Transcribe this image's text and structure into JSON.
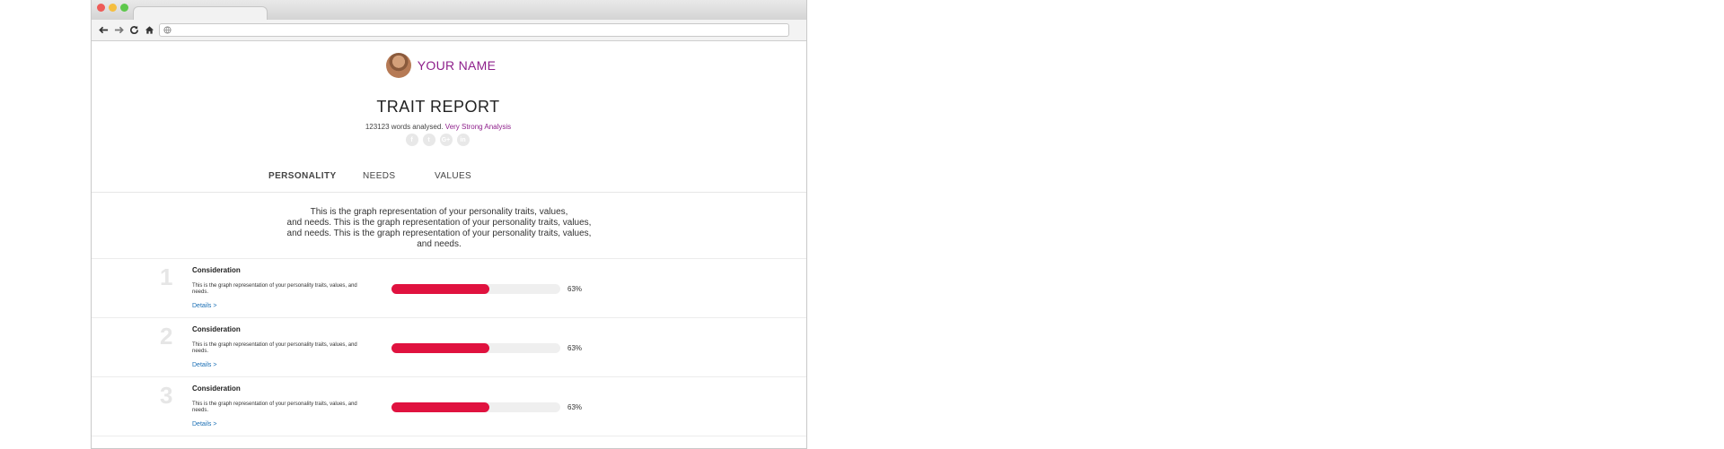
{
  "browser": {
    "traffic_colors": [
      "#ee5b58",
      "#f5be3f",
      "#5ec84c"
    ],
    "nav_icons": [
      "back-icon",
      "forward-icon",
      "reload-icon",
      "home-icon"
    ]
  },
  "profile": {
    "name": "YOUR NAME"
  },
  "report": {
    "title": "TRAIT REPORT",
    "words": "123123 words analysed.",
    "strength": "Very Strong Analysis"
  },
  "socials": [
    {
      "icon": "facebook-icon",
      "glyph": "f"
    },
    {
      "icon": "twitter-icon",
      "glyph": "t"
    },
    {
      "icon": "google-plus-icon",
      "glyph": "G+"
    },
    {
      "icon": "linkedin-icon",
      "glyph": "in"
    }
  ],
  "tabs": [
    {
      "label": "PERSONALITY",
      "active": true
    },
    {
      "label": "NEEDS",
      "active": false
    },
    {
      "label": "VALUES",
      "active": false
    }
  ],
  "intro": [
    "This is the graph representation of your personality traits, values,",
    "and needs. This is the graph representation of your personality traits, values,",
    "and needs. This is the graph representation of your personality traits, values,",
    "and needs."
  ],
  "traits": [
    {
      "rank": "1",
      "name": "Consideration",
      "description": "This is the graph representation of your personality traits, values, and needs.",
      "details": "Details >",
      "percent_label": "63%",
      "percent": 0.58
    },
    {
      "rank": "2",
      "name": "Consideration",
      "description": "This is the graph representation of your personality traits, values, and needs.",
      "details": "Details >",
      "percent_label": "63%",
      "percent": 0.58
    },
    {
      "rank": "3",
      "name": "Consideration",
      "description": "This is the graph representation of your personality traits, values, and needs.",
      "details": "Details >",
      "percent_label": "63%",
      "percent": 0.58
    }
  ],
  "colors": {
    "accent": "#8e1f8b",
    "bar": "#e0123f",
    "link": "#1a6fb5"
  }
}
